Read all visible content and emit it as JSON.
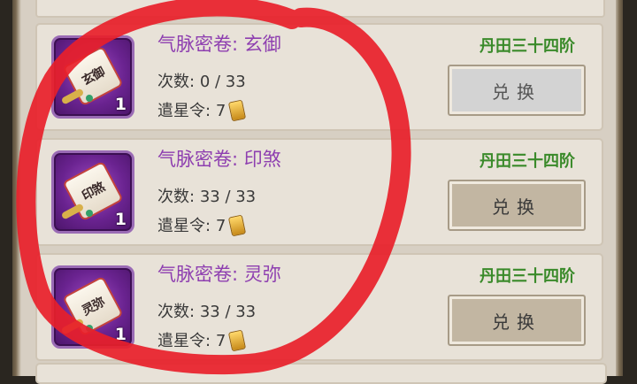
{
  "colors": {
    "panel_bg": "#d7cfc3",
    "card_bg": "#e8e2d8",
    "item_name": "#8e3fb0",
    "requirement": "#3a8a2a",
    "icon_bg": "#6a2390",
    "annotation_stroke": "#e8202a"
  },
  "items": [
    {
      "name": "气脉密卷: 玄御",
      "scroll_text": "玄御",
      "count": "1",
      "times_label": "次数:",
      "times_value": "0 / 33",
      "cost_label": "遣星令:",
      "cost_value": "7",
      "cost_icon": "token-icon",
      "requirement": "丹田三十四阶",
      "button_label": "兑换",
      "button_state": "disabled"
    },
    {
      "name": "气脉密卷: 印煞",
      "scroll_text": "印煞",
      "count": "1",
      "times_label": "次数:",
      "times_value": "33 / 33",
      "cost_label": "遣星令:",
      "cost_value": "7",
      "cost_icon": "token-icon",
      "requirement": "丹田三十四阶",
      "button_label": "兑换",
      "button_state": "enabled"
    },
    {
      "name": "气脉密卷: 灵弥",
      "scroll_text": "灵弥",
      "count": "1",
      "times_label": "次数:",
      "times_value": "33 / 33",
      "cost_label": "遣星令:",
      "cost_value": "7",
      "cost_icon": "token-icon",
      "requirement": "丹田三十四阶",
      "button_label": "兑换",
      "button_state": "enabled"
    }
  ]
}
